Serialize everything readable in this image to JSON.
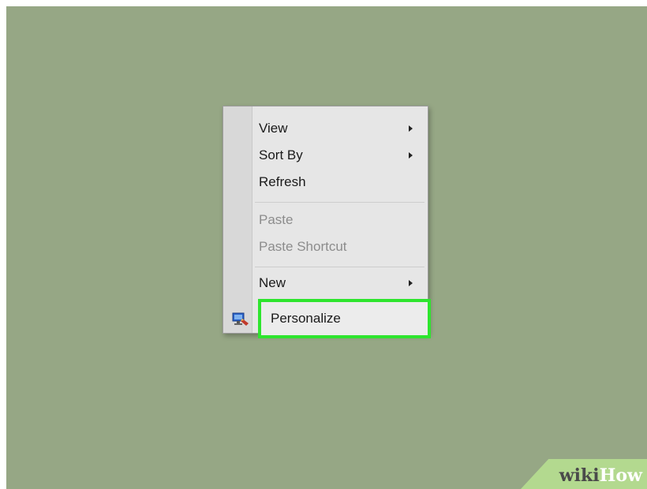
{
  "context_menu": {
    "items": [
      {
        "label": "View",
        "has_submenu": true,
        "enabled": true
      },
      {
        "label": "Sort By",
        "has_submenu": true,
        "enabled": true
      },
      {
        "label": "Refresh",
        "has_submenu": false,
        "enabled": true
      },
      {
        "label": "Paste",
        "has_submenu": false,
        "enabled": false
      },
      {
        "label": "Paste Shortcut",
        "has_submenu": false,
        "enabled": false
      },
      {
        "label": "New",
        "has_submenu": true,
        "enabled": true
      },
      {
        "label": "Personalize",
        "has_submenu": false,
        "enabled": true,
        "highlighted": true,
        "icon": "personalize-monitor-icon"
      }
    ]
  },
  "colors": {
    "desktop_background": "#96a785",
    "highlight_border": "#2ee52e",
    "watermark_band": "#b3d98f"
  },
  "watermark": {
    "part1": "wiki",
    "part2": "How"
  }
}
